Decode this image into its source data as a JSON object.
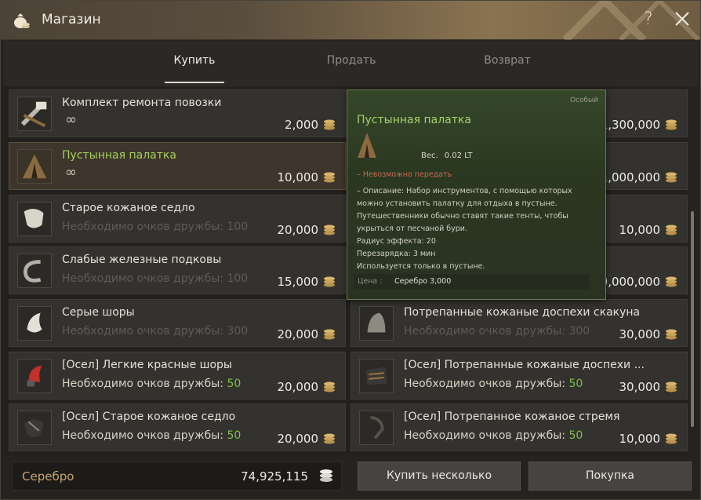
{
  "window": {
    "title": "Магазин"
  },
  "tabs": [
    {
      "label": "Купить"
    },
    {
      "label": "Продать"
    },
    {
      "label": "Возврат"
    }
  ],
  "items": [
    {
      "name": "Комплект ремонта повозки",
      "sub": "∞",
      "price": "2,000"
    },
    {
      "name": "Пустынная палатка",
      "sub": "∞",
      "price": "10,000"
    },
    {
      "name": "Старое кожаное седло",
      "req": "Необходимо очков дружбы:",
      "req_num": "100",
      "price": "20,000"
    },
    {
      "name": "Слабые железные подковы",
      "req": "Необходимо очков дружбы:",
      "req_num": "100",
      "price": "15,000"
    },
    {
      "name": "Серые шоры",
      "req": "Необходимо очков дружбы:",
      "req_num": "300",
      "price": "20,000"
    },
    {
      "name": "[Осел] Легкие красные шоры",
      "req": "Необходимо очков дружбы:",
      "req_num": "50",
      "price": "20,000"
    },
    {
      "name": "[Осел] Старое кожаное седло",
      "req": "Необходимо очков дружбы:",
      "req_num": "50",
      "price": "20,000"
    },
    {
      "name": "",
      "price": "1,300,000"
    },
    {
      "name": "",
      "price": "1,000,000"
    },
    {
      "name": "",
      "price": "10,000"
    },
    {
      "name": "",
      "price": "10,000,000"
    },
    {
      "name": "Потрепанные кожаные доспехи скакуна",
      "req": "Необходимо очков дружбы:",
      "req_num": "300",
      "price": "30,000"
    },
    {
      "name": "[Осел] Потрепанные кожаные доспехи ...",
      "req": "Необходимо очков дружбы:",
      "req_num": "50",
      "price": "30,000"
    },
    {
      "name": "[Осел] Потрепанное кожаное стремя",
      "req": "Необходимо очков дружбы:",
      "req_num": "50",
      "price": "10,000"
    }
  ],
  "tooltip": {
    "grade": "Особый",
    "name": "Пустынная палатка",
    "weight_label": "Вес.",
    "weight_value": "0.02 LT",
    "untradeable": "– Невозможно передать",
    "desc1": "– Описание: Набор инструментов, с помощью которых",
    "desc2": "можно установить палатку для отдыха в пустыне.",
    "desc3": "Путешественники обычно ставят такие тенты, чтобы",
    "desc4": "укрыться от песчаной бури.",
    "radius": "Радиус эффекта: 20",
    "cooldown": "Перезарядка: 3 мин",
    "usage": "Используется только в пустыне.",
    "price_label": "Цена :",
    "price_value": "Серебро 3,000"
  },
  "footer": {
    "silver_label": "Серебро",
    "silver_value": "74,925,115",
    "buy_many": "Купить несколько",
    "purchase": "Покупка"
  },
  "colors": {
    "accent_green": "#a6d06a",
    "friendship_ok": "#7ec04a",
    "silver_gold": "#c9a56a"
  }
}
